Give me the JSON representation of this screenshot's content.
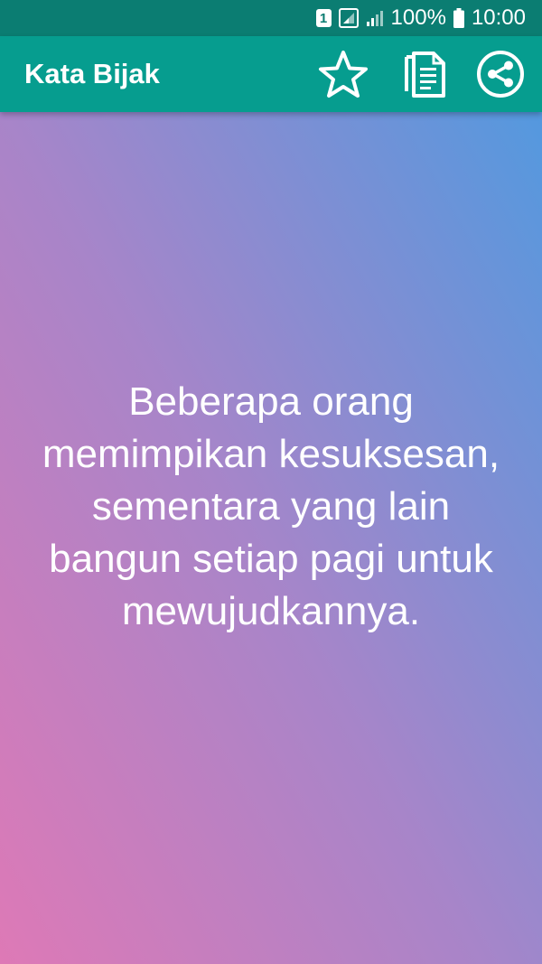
{
  "status_bar": {
    "sim_slot": "1",
    "battery": "100%",
    "time": "10:00"
  },
  "app_bar": {
    "title": "Kata Bijak",
    "actions": [
      {
        "icon": "star-outline-icon"
      },
      {
        "icon": "copy-document-icon"
      },
      {
        "icon": "share-icon"
      }
    ]
  },
  "quote": {
    "text": "Beberapa orang memimpikan kesuksesan, sementara yang lain bangun setiap pagi untuk mewujudkannya."
  },
  "colors": {
    "status_bar": "#0b7d72",
    "app_bar": "#069d8f",
    "gradient_top_right": "#4a9be1",
    "gradient_middle": "#a785c9",
    "gradient_bottom_left": "#de79b6"
  }
}
